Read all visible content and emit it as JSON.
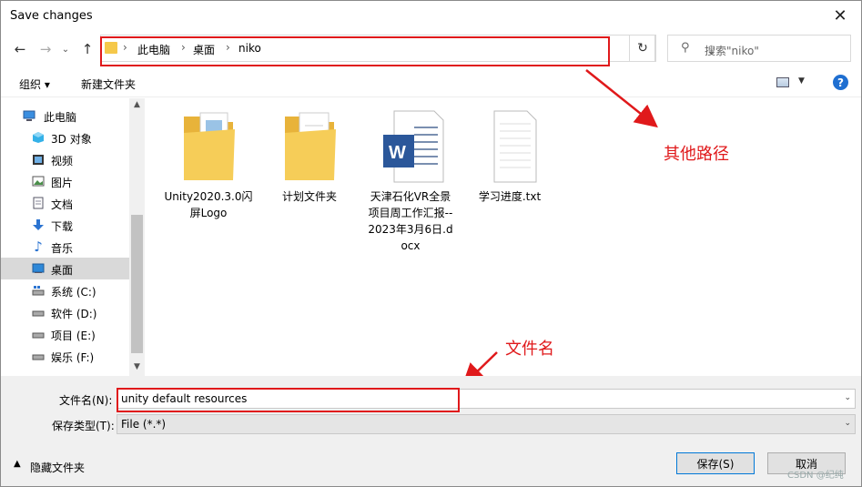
{
  "window": {
    "title": "Save changes"
  },
  "nav": {
    "breadcrumb": [
      "此电脑",
      "桌面",
      "niko"
    ],
    "search_placeholder": "搜索\"niko\""
  },
  "toolbar": {
    "organize": "组织 ▾",
    "new_folder": "新建文件夹"
  },
  "sidebar": {
    "items": [
      {
        "label": "此电脑",
        "icon": "computer-icon"
      },
      {
        "label": "3D 对象",
        "icon": "cube-icon"
      },
      {
        "label": "视频",
        "icon": "video-icon"
      },
      {
        "label": "图片",
        "icon": "picture-icon"
      },
      {
        "label": "文档",
        "icon": "document-icon"
      },
      {
        "label": "下载",
        "icon": "download-icon"
      },
      {
        "label": "音乐",
        "icon": "music-icon"
      },
      {
        "label": "桌面",
        "icon": "desktop-icon",
        "selected": true
      },
      {
        "label": "系统 (C:)",
        "icon": "drive-icon"
      },
      {
        "label": "软件 (D:)",
        "icon": "drive-icon"
      },
      {
        "label": "项目 (E:)",
        "icon": "drive-icon"
      },
      {
        "label": "娱乐 (F:)",
        "icon": "drive-icon"
      }
    ]
  },
  "files": [
    {
      "name": "Unity2020.3.0闪屏Logo",
      "type": "folder"
    },
    {
      "name": "计划文件夹",
      "type": "folder"
    },
    {
      "name": "天津石化VR全景项目周工作汇报--2023年3月6日.docx",
      "type": "word"
    },
    {
      "name": "学习进度.txt",
      "type": "text"
    }
  ],
  "annotations": {
    "other_path": "其他路径",
    "file_name": "文件名"
  },
  "form": {
    "filename_label": "文件名(N):",
    "filename_value": "unity default resources",
    "filetype_label": "保存类型(T):",
    "filetype_value": "File (*.*)"
  },
  "footer": {
    "hide_folders": "隐藏文件夹",
    "save": "保存(S)",
    "cancel": "取消",
    "watermark": "CSDN @纪纯"
  },
  "colors": {
    "accent_red": "#e0191b",
    "selection": "#d9d9d9",
    "primary_border": "#0078d7"
  }
}
